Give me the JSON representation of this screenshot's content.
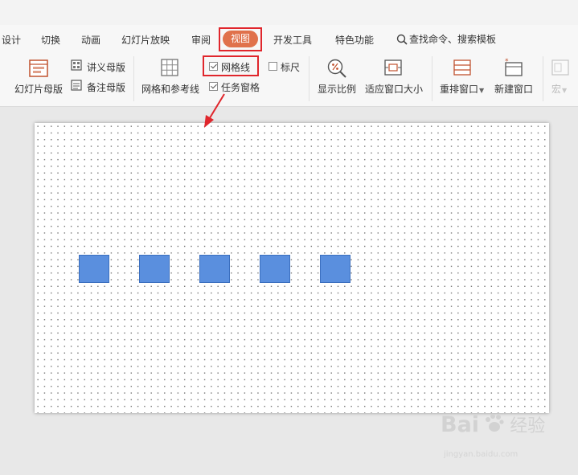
{
  "tabs": [
    {
      "id": "design",
      "label": "设计"
    },
    {
      "id": "transition",
      "label": "切换"
    },
    {
      "id": "animation",
      "label": "动画"
    },
    {
      "id": "slideshow",
      "label": "幻灯片放映"
    },
    {
      "id": "review",
      "label": "审阅"
    },
    {
      "id": "view",
      "label": "视图",
      "active": true
    },
    {
      "id": "developer",
      "label": "开发工具"
    },
    {
      "id": "special",
      "label": "特色功能"
    }
  ],
  "search": {
    "label": "查找命令、搜索模板"
  },
  "ribbon": {
    "slide_master": "幻灯片母版",
    "handout_master": "讲义母版",
    "notes_master": "备注母版",
    "grid_guides": "网格和参考线",
    "gridlines": {
      "label": "网格线",
      "checked": true
    },
    "ruler": {
      "label": "标尺",
      "checked": false
    },
    "task_pane": {
      "label": "任务窗格",
      "checked": true
    },
    "zoom": "显示比例",
    "fit_window": "适应窗口大小",
    "arrange_window": "重排窗口",
    "new_window": "新建窗口",
    "macro": "宏"
  },
  "slide": {
    "shapes_count": 5,
    "shape_color": "#5a8fde"
  },
  "colors": {
    "accent": "#e0714b",
    "highlight": "#e0262c"
  },
  "watermark": {
    "logo": "Bai",
    "cn": "经验",
    "url": "jingyan.baidu.com"
  }
}
